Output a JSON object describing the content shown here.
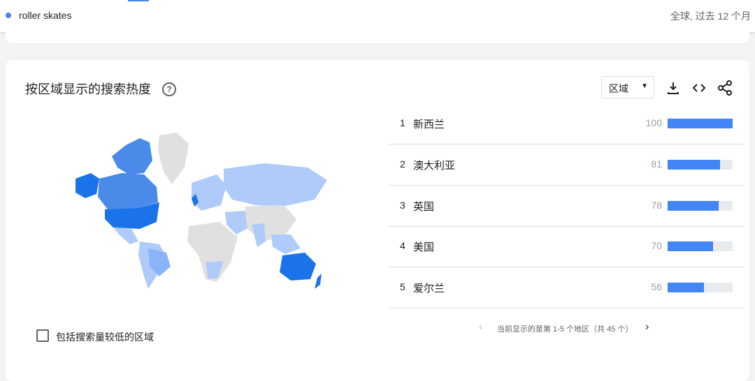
{
  "header": {
    "term": "roller skates",
    "scope": "全球, 过去 12 个月"
  },
  "colors": {
    "accent": "#4285f4",
    "map_dark": "#1a73e8",
    "map_mid": "#4a8ae8",
    "map_light": "#8ab4f8",
    "map_lighter": "#aecbfa",
    "map_gray": "#e0e0e0"
  },
  "section": {
    "title": "按区域显示的搜索热度",
    "help_icon": "help-circle-icon",
    "resolution_dropdown": "区域",
    "icons": [
      "download-icon",
      "embed-code-icon",
      "share-icon"
    ]
  },
  "rankings": [
    {
      "rank": "1",
      "region": "新西兰",
      "value": 100
    },
    {
      "rank": "2",
      "region": "澳大利亚",
      "value": 81
    },
    {
      "rank": "3",
      "region": "英国",
      "value": 78
    },
    {
      "rank": "4",
      "region": "美国",
      "value": 70
    },
    {
      "rank": "5",
      "region": "爱尔兰",
      "value": 56
    }
  ],
  "pagination": {
    "text": "当前显示的是第 1-5 个地区（共 45 个）"
  },
  "options": {
    "low_volume_label": "包括搜索量较低的区域",
    "low_volume_checked": false
  }
}
